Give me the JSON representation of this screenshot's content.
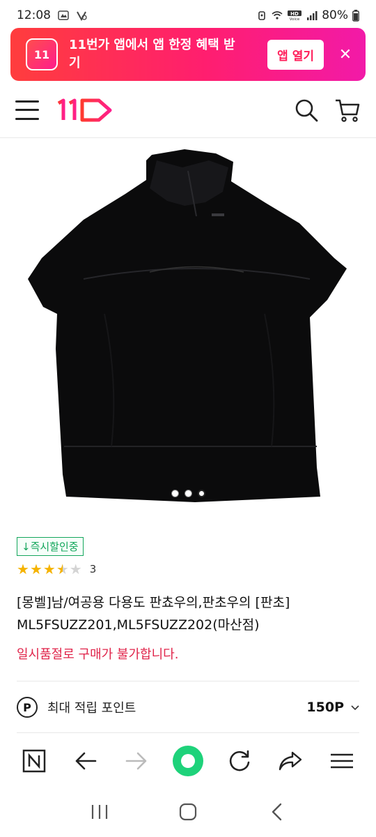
{
  "status": {
    "time": "12:08",
    "battery": "80%"
  },
  "banner": {
    "logo_text": "11",
    "message": "11번가 앱에서 앱 한정 혜택 받기",
    "open_label": "앱 열기",
    "close_glyph": "✕"
  },
  "header": {
    "logo_text": "11"
  },
  "product": {
    "badge": "↓즉시할인중",
    "rating": 3.5,
    "rating_count": "3",
    "title": "[몽벨]남/여공용 다용도 판쵸우의,판초우의 [판초] ML5FSUZZ201,ML5FSUZZ202(마산점)",
    "soldout_notice": "일시품절로 구매가 불가합니다.",
    "carousel": {
      "total": 3,
      "active": 3
    }
  },
  "points": {
    "icon_glyph": "P",
    "label": "최대 적립 포인트",
    "value": "150P"
  },
  "browser_toolbar": {
    "items": [
      "n-icon",
      "back-icon",
      "forward-icon",
      "home-icon",
      "reload-icon",
      "share-icon",
      "menu-icon"
    ]
  },
  "system_nav": {
    "items": [
      "recents-icon",
      "home-icon",
      "back-icon"
    ]
  },
  "colors": {
    "brand": "#ff1e5a",
    "badge_green": "#14a65c",
    "soldout_red": "#e0244a",
    "star": "#f5b301",
    "toolbar_green": "#1ed27a"
  }
}
